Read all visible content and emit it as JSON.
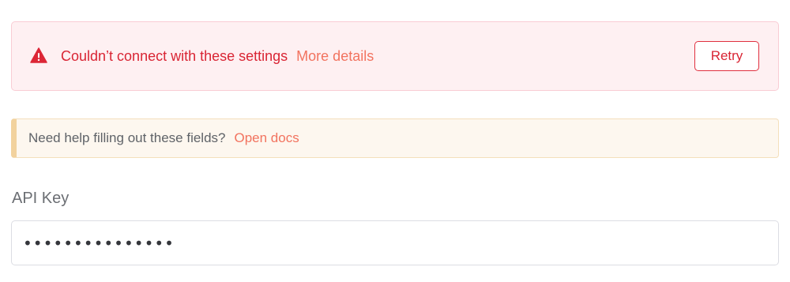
{
  "error_banner": {
    "icon": "warning-triangle-icon",
    "message": "Couldn’t connect with these settings",
    "details_link": "More details",
    "retry_label": "Retry"
  },
  "help_banner": {
    "text": "Need help filling out these fields?",
    "docs_link": "Open docs"
  },
  "api_key": {
    "label": "API Key",
    "value": "•••••••••••••••"
  },
  "colors": {
    "error_red": "#d92534",
    "error_bg": "#fef0f2",
    "link_coral": "#f2735f",
    "help_bg": "#fdf7ef",
    "help_accent": "#f2d29e"
  }
}
